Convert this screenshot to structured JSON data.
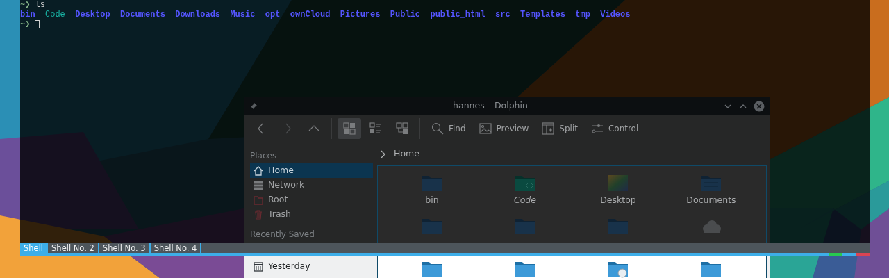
{
  "terminal": {
    "command_line": {
      "prompt": "~❯",
      "command": "ls"
    },
    "ls_output": [
      {
        "name": "bin",
        "kind": "dir"
      },
      {
        "name": "Code",
        "kind": "link"
      },
      {
        "name": "Desktop",
        "kind": "dir"
      },
      {
        "name": "Documents",
        "kind": "dir"
      },
      {
        "name": "Downloads",
        "kind": "dir"
      },
      {
        "name": "Music",
        "kind": "dir"
      },
      {
        "name": "opt",
        "kind": "dir"
      },
      {
        "name": "ownCloud",
        "kind": "dir"
      },
      {
        "name": "Pictures",
        "kind": "dir"
      },
      {
        "name": "Public",
        "kind": "dir"
      },
      {
        "name": "public_html",
        "kind": "dir"
      },
      {
        "name": "src",
        "kind": "dir"
      },
      {
        "name": "Templates",
        "kind": "dir"
      },
      {
        "name": "tmp",
        "kind": "dir"
      },
      {
        "name": "Videos",
        "kind": "dir"
      }
    ],
    "current_line": {
      "prompt": "~❯"
    },
    "tabs": [
      {
        "label": "Shell",
        "selected": true
      },
      {
        "label": "Shell No. 2",
        "selected": false
      },
      {
        "label": "Shell No. 3",
        "selected": false
      },
      {
        "label": "Shell No. 4",
        "selected": false
      }
    ]
  },
  "dolphin": {
    "title": "hannes – Dolphin",
    "view_modes": [
      {
        "selected": true
      },
      {
        "selected": false
      },
      {
        "selected": false
      }
    ],
    "actions": [
      {
        "label": "Find",
        "kind": "find"
      },
      {
        "label": "Preview",
        "kind": "preview"
      },
      {
        "label": "Split",
        "kind": "split"
      },
      {
        "label": "Control",
        "kind": "control"
      }
    ],
    "places": {
      "heading": "Places",
      "items": [
        {
          "label": "Home",
          "kind": "home",
          "selected": true
        },
        {
          "label": "Network",
          "kind": "network",
          "selected": false
        },
        {
          "label": "Root",
          "kind": "root",
          "selected": false
        },
        {
          "label": "Trash",
          "kind": "trash",
          "selected": false
        }
      ]
    },
    "recent": {
      "heading": "Recently Saved",
      "items": [
        {
          "label": "Yesterday",
          "kind": "calendar",
          "selected": false
        }
      ]
    },
    "location": "Home",
    "files": [
      {
        "name": "bin",
        "kind": "folder",
        "link": false
      },
      {
        "name": "Code",
        "kind": "code",
        "link": true
      },
      {
        "name": "Desktop",
        "kind": "desktop",
        "link": false
      },
      {
        "name": "Documents",
        "kind": "documents",
        "link": false
      },
      {
        "kind": "folder"
      },
      {
        "kind": "folder"
      },
      {
        "kind": "folder"
      },
      {
        "kind": "cloud"
      },
      {
        "kind": "folder"
      },
      {
        "kind": "folder"
      },
      {
        "kind": "web"
      },
      {
        "kind": "folder"
      }
    ]
  }
}
